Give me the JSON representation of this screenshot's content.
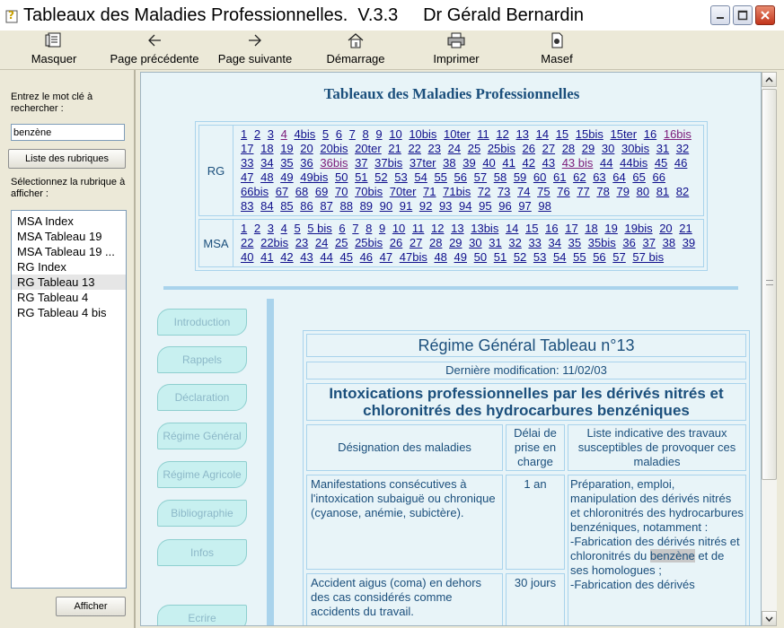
{
  "window": {
    "title": "Tableaux des Maladies Professionnelles.  V.3.3     Dr Gérald Bernardin"
  },
  "toolbar": {
    "items": [
      {
        "label": "Masquer",
        "icon": "hide-panel-icon"
      },
      {
        "label": "Page précédente",
        "icon": "arrow-left-icon"
      },
      {
        "label": "Page suivante",
        "icon": "arrow-right-icon"
      },
      {
        "label": "Démarrage",
        "icon": "home-icon"
      },
      {
        "label": "Imprimer",
        "icon": "printer-icon"
      },
      {
        "label": "Masef",
        "icon": "masef-icon"
      }
    ]
  },
  "sidebar": {
    "search_prompt": "Entrez le mot clé à rechercher :",
    "search_value": "benzène",
    "list_button": "Liste des rubriques",
    "select_prompt": "Sélectionnez la rubrique à afficher :",
    "results": [
      "MSA Index",
      "MSA Tableau 19",
      "MSA Tableau 19 ...",
      "RG Index",
      "RG Tableau 13",
      "RG Tableau 4",
      "RG Tableau 4 bis"
    ],
    "selected_index": 4,
    "show_button": "Afficher"
  },
  "content": {
    "heading": "Tableaux des Maladies Professionnelles",
    "index": [
      {
        "label": "RG",
        "links": [
          "1",
          "2",
          "3",
          "4",
          "4bis",
          "5",
          "6",
          "7",
          "8",
          "9",
          "10",
          "10bis",
          "10ter",
          "11",
          "12",
          "13",
          "14",
          "15",
          "15bis",
          "15ter",
          "16",
          "16bis",
          "17",
          "18",
          "19",
          "20",
          "20bis",
          "20ter",
          "21",
          "22",
          "23",
          "24",
          "25",
          "25bis",
          "26",
          "27",
          "28",
          "29",
          "30",
          "30bis",
          "31",
          "32",
          "33",
          "34",
          "35",
          "36",
          "36bis",
          "37",
          "37bis",
          "37ter",
          "38",
          "39",
          "40",
          "41",
          "42",
          "43",
          "43 bis",
          "44",
          "44bis",
          "45",
          "46",
          "47",
          "48",
          "49",
          "49bis",
          "50",
          "51",
          "52",
          "53",
          "54",
          "55",
          "56",
          "57",
          "58",
          "59",
          "60",
          "61",
          "62",
          "63",
          "64",
          "65",
          "66",
          "66bis",
          "67",
          "68",
          "69",
          "70",
          "70bis",
          "70ter",
          "71",
          "71bis",
          "72",
          "73",
          "74",
          "75",
          "76",
          "77",
          "78",
          "79",
          "80",
          "81",
          "82",
          "83",
          "84",
          "85",
          "86",
          "87",
          "88",
          "89",
          "90",
          "91",
          "92",
          "93",
          "94",
          "95",
          "96",
          "97",
          "98"
        ],
        "visited": [
          "4",
          "16bis",
          "36bis",
          "43 bis"
        ]
      },
      {
        "label": "MSA",
        "links": [
          "1",
          "2",
          "3",
          "4",
          "5",
          "5 bis",
          "6",
          "7",
          "8",
          "9",
          "10",
          "11",
          "12",
          "13",
          "13bis",
          "14",
          "15",
          "16",
          "17",
          "18",
          "19",
          "19bis",
          "20",
          "21",
          "22",
          "22bis",
          "23",
          "24",
          "25",
          "25bis",
          "26",
          "27",
          "28",
          "29",
          "30",
          "31",
          "32",
          "33",
          "34",
          "35",
          "35bis",
          "36",
          "37",
          "38",
          "39",
          "40",
          "41",
          "42",
          "43",
          "44",
          "45",
          "46",
          "47",
          "47bis",
          "48",
          "49",
          "50",
          "51",
          "52",
          "53",
          "54",
          "55",
          "56",
          "57",
          "57 bis"
        ],
        "visited": []
      }
    ],
    "nav_buttons": [
      "Introduction",
      "Rappels",
      "Déclaration",
      "Régime Général",
      "Régime Agricole",
      "Bibliographie",
      "Infos",
      "Ecrire"
    ],
    "document": {
      "title": "Régime Général Tableau n°13",
      "last_modified": "Dernière modification: 11/02/03",
      "subject": "Intoxications professionnelles par les dérivés nitrés et chloronitrés des hydrocarbures benzéniques",
      "columns": [
        "Désignation des maladies",
        "Délai de prise en charge",
        "Liste indicative des travaux susceptibles de provoquer ces maladies"
      ],
      "rows": [
        {
          "disease": "Manifestations consécutives à l'intoxication  subaiguë ou chronique (cyanose, anémie, subictère).",
          "delay": "1 an",
          "works_before": "Préparation, emploi, manipulation des dérivés nitrés  et chloronitrés des hydrocarbures benzéniques, notamment :",
          "works_line2": "-Fabrication des dérivés nitrés et chloronitrés du",
          "works_highlight": "benzène",
          "works_after": " et de ses homologues ;",
          "works_line4": "-Fabrication des dérivés"
        },
        {
          "disease": "Accident aigus (coma) en dehors des cas  considérés comme accidents du travail.",
          "delay": "30 jours"
        }
      ]
    }
  }
}
